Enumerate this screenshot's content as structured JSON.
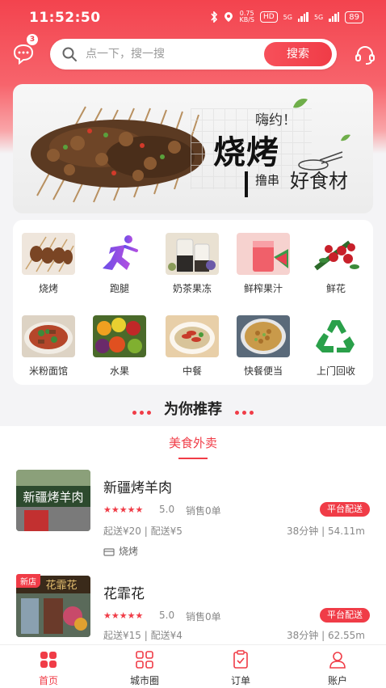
{
  "status_bar": {
    "time": "11:52:50",
    "net_speed": "0.75",
    "net_unit": "KB/S",
    "hd": "HD",
    "signal1": "5G",
    "signal2": "5G",
    "battery": "89"
  },
  "header": {
    "message_badge": "3",
    "search_placeholder": "点一下，搜一搜",
    "search_button": "搜索"
  },
  "banner": {
    "small_text": "嗨约！",
    "title": "烧烤",
    "sub_text_a": "撸串",
    "sub_text_b": "好食材"
  },
  "categories": [
    {
      "label": "烧烤",
      "icon": "bbq-image"
    },
    {
      "label": "跑腿",
      "icon": "runner-icon"
    },
    {
      "label": "奶茶果冻",
      "icon": "milk-tea-image"
    },
    {
      "label": "鲜榨果汁",
      "icon": "juice-image"
    },
    {
      "label": "鲜花",
      "icon": "flowers-image"
    },
    {
      "label": "米粉面馆",
      "icon": "noodles-image"
    },
    {
      "label": "水果",
      "icon": "fruit-image"
    },
    {
      "label": "中餐",
      "icon": "chinese-food-image"
    },
    {
      "label": "快餐便当",
      "icon": "fast-food-image"
    },
    {
      "label": "上门回收",
      "icon": "recycle-icon"
    }
  ],
  "recommend_title": "为你推荐",
  "list_tab": "美食外卖",
  "shops": [
    {
      "name": "新疆烤羊肉",
      "rating": "5.0",
      "sales": "销售0单",
      "badge": "平台配送",
      "fee": "起送¥20 | 配送¥5",
      "distance": "38分钟 | 54.11m",
      "tag": "烧烤",
      "new": "",
      "storefront_text": "新疆烤羊肉"
    },
    {
      "name": "花霏花",
      "rating": "5.0",
      "sales": "销售0单",
      "badge": "平台配送",
      "fee": "起送¥15 | 配送¥4",
      "distance": "38分钟 | 62.55m",
      "tag": "",
      "new": "新店",
      "storefront_text": "花霏花"
    }
  ],
  "tabbar": [
    {
      "label": "首页",
      "icon": "home-icon",
      "active": true
    },
    {
      "label": "城市圈",
      "icon": "city-circle-icon",
      "active": false
    },
    {
      "label": "订单",
      "icon": "orders-icon",
      "active": false
    },
    {
      "label": "账户",
      "icon": "account-icon",
      "active": false
    }
  ],
  "colors": {
    "brand": "#f03c47",
    "background": "#f4f4f6"
  }
}
